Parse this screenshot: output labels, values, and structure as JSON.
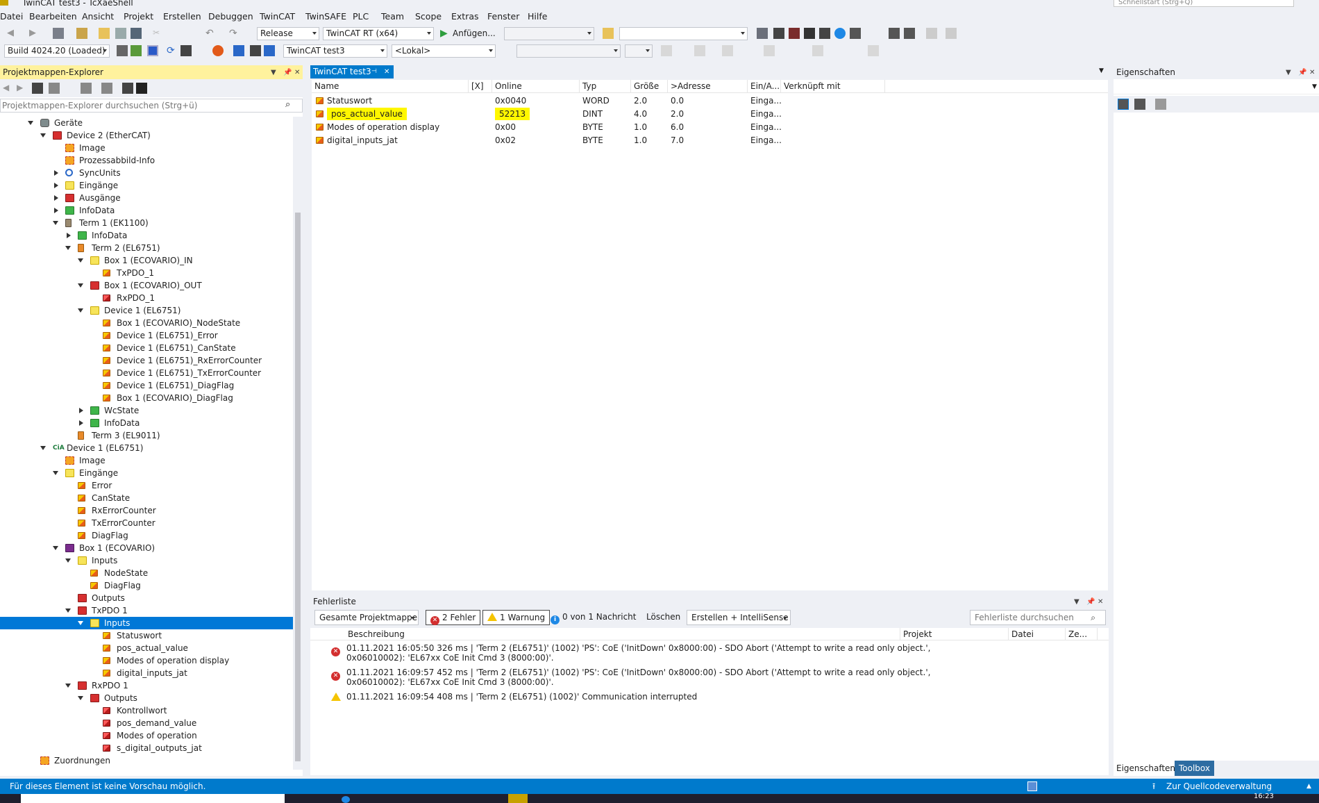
{
  "window": {
    "title": "TwinCAT test3 - TcXaeShell",
    "quick_launch": "Schnellstart (Strg+Q)"
  },
  "menu": [
    "Datei",
    "Bearbeiten",
    "Ansicht",
    "Projekt",
    "Erstellen",
    "Debuggen",
    "TwinCAT",
    "TwinSAFE",
    "PLC",
    "Team",
    "Scope",
    "Extras",
    "Fenster",
    "Hilfe"
  ],
  "toolbar1": {
    "config": "Release",
    "platform": "TwinCAT RT (x64)",
    "attach": "Anfügen...",
    "combo_empty": ""
  },
  "toolbar2": {
    "build": "Build 4024.20 (Loaded)",
    "project": "TwinCAT test3",
    "target": "<Lokal>"
  },
  "solution_explorer": {
    "title": "Projektmappen-Explorer",
    "search_placeholder": "Projektmappen-Explorer durchsuchen (Strg+ü)",
    "tree": [
      {
        "label": "Geräte",
        "icon": "gear-icon",
        "exp": "open"
      },
      {
        "label": "Device 2 (EtherCAT)",
        "icon": "ethercat-device-icon",
        "exp": "open"
      },
      {
        "label": "Image",
        "icon": "image-icon",
        "exp": ""
      },
      {
        "label": "Prozessabbild-Info",
        "icon": "image-icon",
        "exp": ""
      },
      {
        "label": "SyncUnits",
        "icon": "sync-icon",
        "exp": "closed"
      },
      {
        "label": "Eingänge",
        "icon": "input-folder-icon",
        "exp": "closed"
      },
      {
        "label": "Ausgänge",
        "icon": "output-folder-icon",
        "exp": "closed"
      },
      {
        "label": "InfoData",
        "icon": "infodata-folder-icon",
        "exp": "closed"
      },
      {
        "label": "Term 1 (EK1100)",
        "icon": "terminal-icon",
        "exp": "open"
      },
      {
        "label": "InfoData",
        "icon": "infodata-folder-icon",
        "exp": "closed"
      },
      {
        "label": "Term 2 (EL6751)",
        "icon": "terminal-orange-icon",
        "exp": "open"
      },
      {
        "label": "Box 1 (ECOVARIO)_IN",
        "icon": "input-folder-icon",
        "exp": "open"
      },
      {
        "label": "TxPDO_1",
        "icon": "input-variable-icon",
        "exp": ""
      },
      {
        "label": "Box 1 (ECOVARIO)_OUT",
        "icon": "output-folder-icon",
        "exp": "open"
      },
      {
        "label": "RxPDO_1",
        "icon": "output-variable-icon",
        "exp": ""
      },
      {
        "label": "Device 1 (EL6751)",
        "icon": "input-folder-icon",
        "exp": "open"
      },
      {
        "label": "Box 1 (ECOVARIO)_NodeState",
        "icon": "input-variable-icon",
        "exp": ""
      },
      {
        "label": "Device 1 (EL6751)_Error",
        "icon": "input-variable-icon",
        "exp": ""
      },
      {
        "label": "Device 1 (EL6751)_CanState",
        "icon": "input-variable-icon",
        "exp": ""
      },
      {
        "label": "Device 1 (EL6751)_RxErrorCounter",
        "icon": "input-variable-icon",
        "exp": ""
      },
      {
        "label": "Device 1 (EL6751)_TxErrorCounter",
        "icon": "input-variable-icon",
        "exp": ""
      },
      {
        "label": "Device 1 (EL6751)_DiagFlag",
        "icon": "input-variable-icon",
        "exp": ""
      },
      {
        "label": "Box 1 (ECOVARIO)_DiagFlag",
        "icon": "input-variable-icon",
        "exp": ""
      },
      {
        "label": "WcState",
        "icon": "infodata-folder-icon",
        "exp": "closed"
      },
      {
        "label": "InfoData",
        "icon": "infodata-folder-icon",
        "exp": "closed"
      },
      {
        "label": "Term 3 (EL9011)",
        "icon": "terminal-orange-icon",
        "exp": ""
      },
      {
        "label": "Device 1 (EL6751)",
        "icon": "canopen-cia-icon",
        "exp": "open"
      },
      {
        "label": "Image",
        "icon": "image-icon",
        "exp": ""
      },
      {
        "label": "Eingänge",
        "icon": "input-folder-icon",
        "exp": "open"
      },
      {
        "label": "Error",
        "icon": "input-variable-icon",
        "exp": ""
      },
      {
        "label": "CanState",
        "icon": "input-variable-icon",
        "exp": ""
      },
      {
        "label": "RxErrorCounter",
        "icon": "input-variable-icon",
        "exp": ""
      },
      {
        "label": "TxErrorCounter",
        "icon": "input-variable-icon",
        "exp": ""
      },
      {
        "label": "DiagFlag",
        "icon": "input-variable-icon",
        "exp": ""
      },
      {
        "label": "Box 1 (ECOVARIO)",
        "icon": "box-icon",
        "exp": "open"
      },
      {
        "label": "Inputs",
        "icon": "input-folder-icon",
        "exp": "open"
      },
      {
        "label": "NodeState",
        "icon": "input-variable-icon",
        "exp": ""
      },
      {
        "label": "DiagFlag",
        "icon": "input-variable-icon",
        "exp": ""
      },
      {
        "label": "Outputs",
        "icon": "output-folder-icon",
        "exp": ""
      },
      {
        "label": "TxPDO 1",
        "icon": "txpdo-icon",
        "exp": "open"
      },
      {
        "label": "Inputs",
        "icon": "input-folder-icon",
        "exp": "open",
        "selected": true
      },
      {
        "label": "Statuswort",
        "icon": "input-variable-icon",
        "exp": ""
      },
      {
        "label": "pos_actual_value",
        "icon": "input-variable-icon",
        "exp": ""
      },
      {
        "label": "Modes of operation display",
        "icon": "input-variable-icon",
        "exp": ""
      },
      {
        "label": "digital_inputs_jat",
        "icon": "input-variable-icon",
        "exp": ""
      },
      {
        "label": "RxPDO 1",
        "icon": "rxpdo-icon",
        "exp": "open"
      },
      {
        "label": "Outputs",
        "icon": "output-folder-icon",
        "exp": "open"
      },
      {
        "label": "Kontrollwort",
        "icon": "output-variable-icon",
        "exp": ""
      },
      {
        "label": "pos_demand_value",
        "icon": "output-variable-icon",
        "exp": ""
      },
      {
        "label": "Modes of operation",
        "icon": "output-variable-icon",
        "exp": ""
      },
      {
        "label": "s_digital_outputs_jat",
        "icon": "output-variable-icon",
        "exp": ""
      },
      {
        "label": "Zuordnungen",
        "icon": "mapping-icon",
        "exp": ""
      }
    ]
  },
  "document": {
    "tab": "TwinCAT test3",
    "columns": [
      "Name",
      "[X]",
      "Online",
      "Typ",
      "Größe",
      ">Adresse",
      "Ein/A...",
      "Verknüpft mit"
    ],
    "rows": [
      {
        "name": "Statuswort",
        "x": "",
        "online": "0x0040",
        "typ": "WORD",
        "size": "2.0",
        "addr": "0.0",
        "io": "Einga...",
        "link": ""
      },
      {
        "name": "pos_actual_value",
        "x": "",
        "online": "52213",
        "typ": "DINT",
        "size": "4.0",
        "addr": "2.0",
        "io": "Einga...",
        "link": "",
        "highlight": true
      },
      {
        "name": "Modes of operation display",
        "x": "",
        "online": "0x00",
        "typ": "BYTE",
        "size": "1.0",
        "addr": "6.0",
        "io": "Einga...",
        "link": ""
      },
      {
        "name": "digital_inputs_jat",
        "x": "",
        "online": "0x02",
        "typ": "BYTE",
        "size": "1.0",
        "addr": "7.0",
        "io": "Einga...",
        "link": ""
      }
    ]
  },
  "properties": {
    "title": "Eigenschaften",
    "tab_props": "Eigenschaften",
    "tab_toolbox": "Toolbox"
  },
  "error_list": {
    "title": "Fehlerliste",
    "scope": "Gesamte Projektmappe",
    "errors_btn": "2 Fehler",
    "warnings_btn": "1 Warnung",
    "messages_btn": "0 von 1 Nachricht",
    "clear_btn": "Löschen",
    "build_filter": "Erstellen + IntelliSense",
    "search_placeholder": "Fehlerliste durchsuchen",
    "columns": [
      "Beschreibung",
      "Projekt",
      "Datei",
      "Ze..."
    ],
    "rows": [
      {
        "kind": "error",
        "line1": "01.11.2021 16:05:50 326 ms | 'Term 2 (EL6751)' (1002) 'PS': CoE ('InitDown' 0x8000:00) - SDO Abort ('Attempt to write a read only object.',",
        "line2": "0x06010002): 'EL67xx CoE Init Cmd 3 (8000:00)'."
      },
      {
        "kind": "error",
        "line1": "01.11.2021 16:09:57 452 ms | 'Term 2 (EL6751)' (1002) 'PS': CoE ('InitDown' 0x8000:00) - SDO Abort ('Attempt to write a read only object.',",
        "line2": "0x06010002): 'EL67xx CoE Init Cmd 3 (8000:00)'."
      },
      {
        "kind": "warning",
        "line1": "01.11.2021 16:09:54 408 ms | 'Term 2 (EL6751) (1002)' Communication interrupted",
        "line2": ""
      }
    ]
  },
  "statusbar": {
    "message": "Für dieses Element ist keine Vorschau möglich.",
    "source_control": "Zur Quellcodeverwaltung hinzufügen",
    "clock": "16:23"
  },
  "colors": {
    "accent": "#007acc",
    "selection": "#0078d7",
    "active_panel": "#fff29d",
    "highlight": "#fff700"
  }
}
